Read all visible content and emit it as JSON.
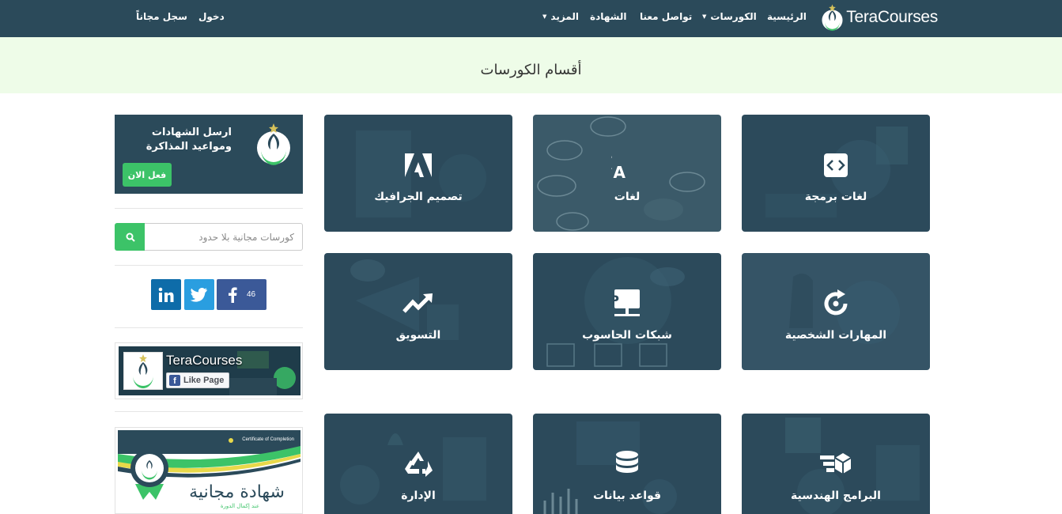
{
  "brand": {
    "name": "TeraCourses"
  },
  "nav": {
    "home": "الرئيسية",
    "courses": "الكورسات",
    "contact": "تواصل معنا",
    "certificate": "الشهادة",
    "more": "المزيد",
    "login": "دخول",
    "register": "سجل مجاناً",
    "dropdown_icon": "caret-down-icon"
  },
  "banner": {
    "title": "أقسام الكورسات"
  },
  "categories": [
    {
      "label": "لغات برمجة",
      "icon": "code-icon"
    },
    {
      "label": "لغات",
      "icon": "translate-icon"
    },
    {
      "label": "تصميم الجرافيك",
      "icon": "adobe-icon"
    },
    {
      "label": "المهارات الشخصية",
      "icon": "refresh-icon"
    },
    {
      "label": "شبكات الحاسوب",
      "icon": "ip-network-icon"
    },
    {
      "label": "التسويق",
      "icon": "trending-up-icon"
    },
    {
      "label": "البرامج الهندسية",
      "icon": "cubes-icon"
    },
    {
      "label": "قواعد بيانات",
      "icon": "database-icon"
    },
    {
      "label": "الإدارة",
      "icon": "recycle-icon"
    }
  ],
  "sidebar": {
    "promo": {
      "text": "ارسل الشهادات ومواعيد المذاكرة",
      "button": "فعل الان"
    },
    "search": {
      "placeholder": "كورسات مجانية بلا حدود",
      "icon": "search-icon"
    },
    "social": {
      "facebook_count": "46"
    },
    "fb_widget": {
      "name": "TeraCourses",
      "like": "Like Page"
    },
    "certificate": {
      "label": "Certificate of Completion",
      "title": "شهادة مجانية",
      "subtitle": "عند إكمال الدورة"
    }
  },
  "colors": {
    "navbar": "#2b4a5a",
    "card": "#2c4a5b",
    "accent": "#3cc368",
    "banner": "#eefce8"
  }
}
